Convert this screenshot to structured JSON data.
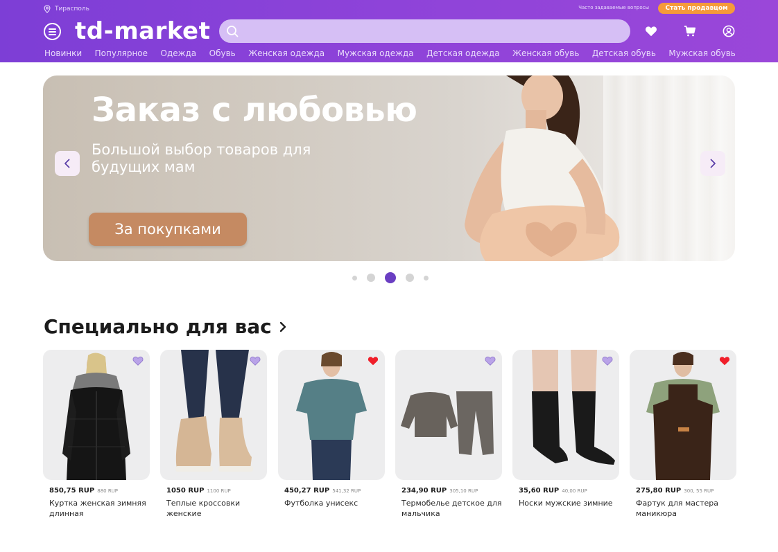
{
  "header": {
    "city": "Тирасполь",
    "faq": "Часто задаваемые вопросы",
    "become_seller": "Стать продавцом",
    "logo": "td-market",
    "search_placeholder": ""
  },
  "categories": [
    "Новинки",
    "Популярное",
    "Одежда",
    "Обувь",
    "Женская одежда",
    "Мужская одежда",
    "Детская одежда",
    "Женская обувь",
    "Детская обувь",
    "Мужская обувь"
  ],
  "banner": {
    "title": "Заказ с любовью",
    "subtitle": "Большой выбор товаров для будущих мам",
    "button": "За покупками",
    "active_slide": 3,
    "slide_count": 5
  },
  "special": {
    "title": "Специально для вас",
    "products": [
      {
        "price": "850,75 RUP",
        "old_price": "880 RUP",
        "name": "Куртка женская зимняя длинная",
        "favorite": false
      },
      {
        "price": "1050 RUP",
        "old_price": "1100 RUP",
        "name": "Теплые кроссовки женские",
        "favorite": false
      },
      {
        "price": "450,27 RUP",
        "old_price": "541,32 RUP",
        "name": "Футболка унисекс",
        "favorite": true
      },
      {
        "price": "234,90 RUP",
        "old_price": "305,10 RUP",
        "name": "Термобелье детское для мальчика",
        "favorite": false
      },
      {
        "price": "35,60 RUP",
        "old_price": "40,00 RUP",
        "name": "Носки мужские зимние",
        "favorite": false
      },
      {
        "price": "275,80 RUP",
        "old_price": "300, 55 RUP",
        "name": "Фартук для мастера маникюра",
        "favorite": true
      }
    ]
  },
  "colors": {
    "header_bg": "#8a42d8",
    "seller_button": "#f59a3a",
    "favorite_active": "#f01f2a",
    "favorite_inactive": "#b9a3e8",
    "dot_active": "#6a3ec2"
  }
}
